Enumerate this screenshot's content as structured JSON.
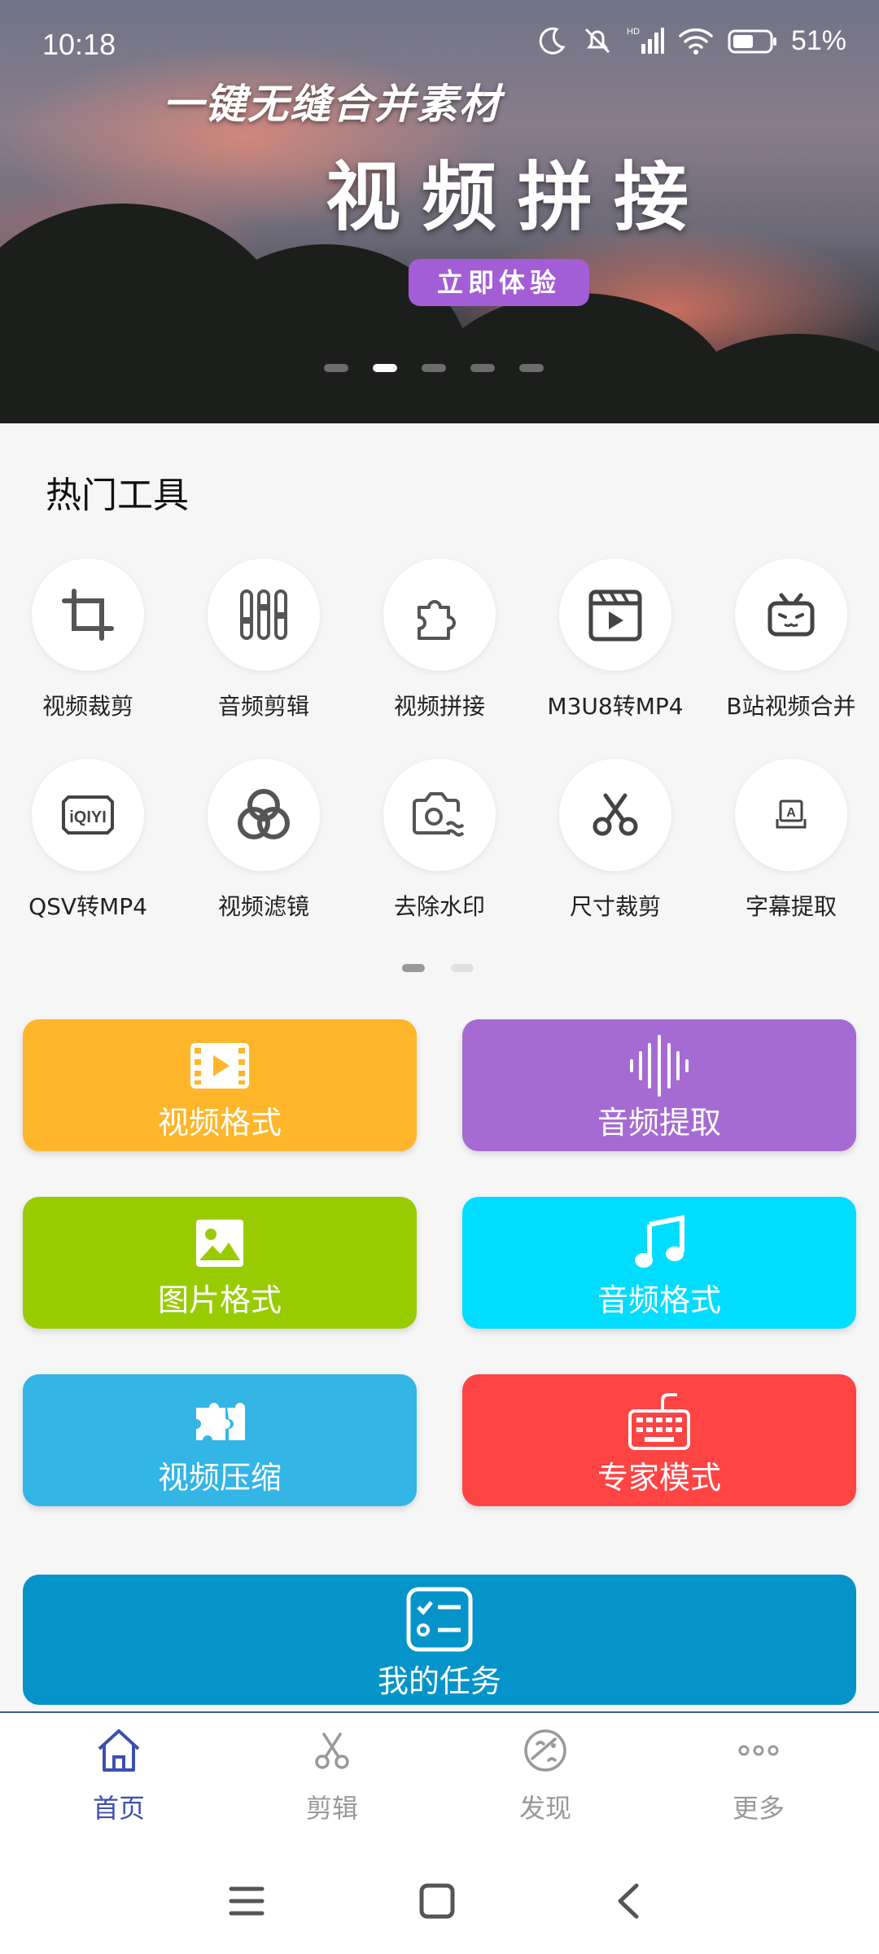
{
  "status": {
    "time": "10:18",
    "battery": "51%"
  },
  "banner": {
    "subtitle": "一键无缝合并素材",
    "title": "视频拼接",
    "button": "立即体验"
  },
  "hot_tools": {
    "title": "热门工具",
    "items": [
      {
        "label": "视频裁剪",
        "icon": "crop-icon"
      },
      {
        "label": "音频剪辑",
        "icon": "equalizer-icon"
      },
      {
        "label": "视频拼接",
        "icon": "puzzle-icon"
      },
      {
        "label": "M3U8转MP4",
        "icon": "clapperboard-icon"
      },
      {
        "label": "B站视频合并",
        "icon": "bilibili-tv-icon"
      },
      {
        "label": "QSV转MP4",
        "icon": "iqiyi-icon"
      },
      {
        "label": "视频滤镜",
        "icon": "filter-circles-icon"
      },
      {
        "label": "去除水印",
        "icon": "camera-wave-icon"
      },
      {
        "label": "尺寸裁剪",
        "icon": "scissors-icon"
      },
      {
        "label": "字幕提取",
        "icon": "subtitle-icon"
      }
    ]
  },
  "cards": [
    {
      "label": "视频格式",
      "color": "#ffb62b",
      "icon": "film-icon"
    },
    {
      "label": "音频提取",
      "color": "#a66bd3",
      "icon": "soundwave-icon"
    },
    {
      "label": "图片格式",
      "color": "#99cc00",
      "icon": "image-icon"
    },
    {
      "label": "音频格式",
      "color": "#00ddff",
      "icon": "music-note-icon"
    },
    {
      "label": "视频压缩",
      "color": "#33b5e5",
      "icon": "puzzle-compress-icon"
    },
    {
      "label": "专家模式",
      "color": "#ff4444",
      "icon": "keyboard-icon"
    }
  ],
  "task": {
    "label": "我的任务",
    "color": "#0494c9",
    "icon": "task-list-icon"
  },
  "bottom_nav": [
    {
      "label": "首页",
      "icon": "home-icon",
      "active": true
    },
    {
      "label": "剪辑",
      "icon": "scissors-icon",
      "active": false
    },
    {
      "label": "发现",
      "icon": "discover-icon",
      "active": false
    },
    {
      "label": "更多",
      "icon": "more-dots-icon",
      "active": false
    }
  ],
  "colors": {
    "accent": "#3d4fb0",
    "banner_button": "#a35dd6"
  }
}
